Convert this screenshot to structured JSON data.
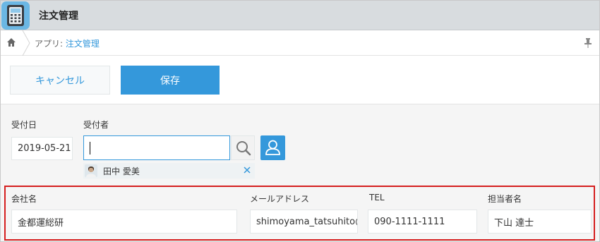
{
  "header": {
    "app_title": "注文管理",
    "app_icon": "telephone-icon"
  },
  "breadcrumb": {
    "home_icon": "home-icon",
    "prefix": "アプリ: ",
    "app_link": "注文管理",
    "pin_icon": "pin-icon"
  },
  "toolbar": {
    "cancel_label": "キャンセル",
    "save_label": "保存"
  },
  "form": {
    "receipt_date": {
      "label": "受付日",
      "value": "2019-05-21"
    },
    "receiver": {
      "label": "受付者",
      "input_value": "",
      "selected_user": "田中 愛美",
      "search_icon": "search-icon",
      "user_picker_icon": "user-icon",
      "remove_icon": "close-icon"
    },
    "company": {
      "label": "会社名",
      "value": "金都運総研"
    },
    "email": {
      "label": "メールアドレス",
      "value": "shimoyama_tatsuhito@"
    },
    "tel": {
      "label": "TEL",
      "value": "090-1111-1111"
    },
    "contact": {
      "label": "担当者名",
      "value": "下山 達士"
    }
  },
  "colors": {
    "accent": "#3498db",
    "header_bg": "#d8dcdf",
    "form_bg": "#f5f5f5",
    "highlight": "#d51f1f"
  }
}
